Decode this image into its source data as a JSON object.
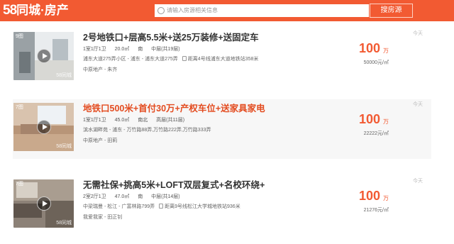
{
  "header": {
    "logo_num": "58",
    "logo_text": "同城·房产",
    "search_placeholder": "请输入房源相关信息",
    "search_button": "搜房源"
  },
  "listings": [
    {
      "photo_count": "9图",
      "watermark": "58同城",
      "title": "2号地铁口+层高5.5米+送25万装修+送固定车",
      "layout": "1室1厅1卫",
      "area": "20.0㎡",
      "orientation": "南",
      "floor": "中层(共19层)",
      "address": "浦东大道275弄小区 - 浦东 - 浦东大道275弄",
      "metro": "距离4号线浦东大道地铁站358米",
      "agent": "中原地产 - 朱齐",
      "price": "100",
      "price_unit": "万",
      "unit_price": "50000元/㎡",
      "date": "今天"
    },
    {
      "photo_count": "7图",
      "watermark": "58同城",
      "title": "地铁口500米+首付30万+产权车位+送家具家电",
      "layout": "1室1厅1卫",
      "area": "45.0㎡",
      "orientation": "南北",
      "floor": "高层(共11层)",
      "address": "滨水湖畔苑 - 浦东 - 万竹路88弄,万竹路222弄,万竹路333弄",
      "metro": "",
      "agent": "中原地产 - 田莉",
      "price": "100",
      "price_unit": "万",
      "unit_price": "22222元/㎡",
      "date": "今天"
    },
    {
      "photo_count": "7图",
      "watermark": "58同城",
      "title": "无需社保+挑高5米+LOFT双层复式+名校环绕+",
      "layout": "2室2厅1卫",
      "area": "47.0㎡",
      "orientation": "南",
      "floor": "中层(共14层)",
      "address": "中梁瑞曼 - 松江 - 广富林路799弄",
      "metro": "距离9号线松江大学城地铁站936米",
      "agent": "我爱我家 - 田正钊",
      "price": "100",
      "price_unit": "万",
      "unit_price": "21276元/㎡",
      "date": "今天"
    }
  ],
  "colors": {
    "brand": "#f25a32",
    "highlight_title": "#e34b1f"
  }
}
